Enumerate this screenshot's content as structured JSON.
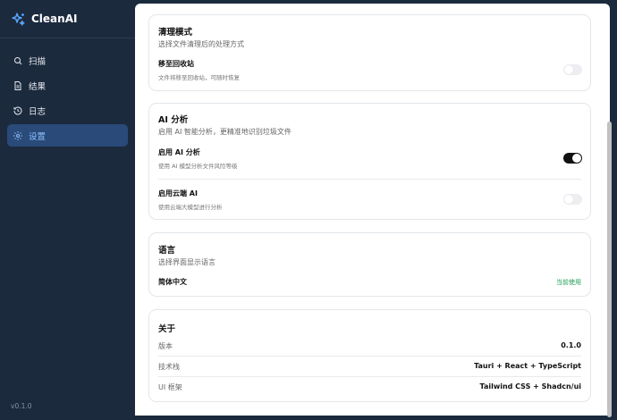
{
  "app": {
    "name": "CleanAI",
    "version": "v0.1.0"
  },
  "sidebar": {
    "items": [
      {
        "label": "扫描",
        "icon": "search-icon",
        "active": false
      },
      {
        "label": "结果",
        "icon": "file-icon",
        "active": false
      },
      {
        "label": "日志",
        "icon": "history-icon",
        "active": false
      },
      {
        "label": "设置",
        "icon": "gear-icon",
        "active": true
      }
    ]
  },
  "cleanup": {
    "title": "清理模式",
    "desc": "选择文件清理后的处理方式",
    "recycle_label": "移至回收站",
    "recycle_sub": "文件将移至回收站，可随时恢复",
    "recycle_on": false
  },
  "ai": {
    "title": "AI 分析",
    "desc": "启用 AI 智能分析，更精准地识别垃圾文件",
    "enable_label": "启用 AI 分析",
    "enable_sub": "使用 AI 模型分析文件风险等级",
    "enable_on": true,
    "cloud_label": "启用云端 AI",
    "cloud_sub": "使用云端大模型进行分析",
    "cloud_on": false
  },
  "language": {
    "title": "语言",
    "desc": "选择界面显示语言",
    "current": "简体中文",
    "status": "当前使用"
  },
  "about": {
    "title": "关于",
    "rows": [
      {
        "label": "版本",
        "value": "0.1.0"
      },
      {
        "label": "技术栈",
        "value": "Tauri + React + TypeScript"
      },
      {
        "label": "UI 框架",
        "value": "Tailwind CSS + Shadcn/ui"
      }
    ]
  },
  "colors": {
    "sidebar_bg": "#1c2a3e",
    "active_bg": "#2a4a7a",
    "active_text": "#8fc0ff",
    "status_green": "#1f9d55"
  }
}
